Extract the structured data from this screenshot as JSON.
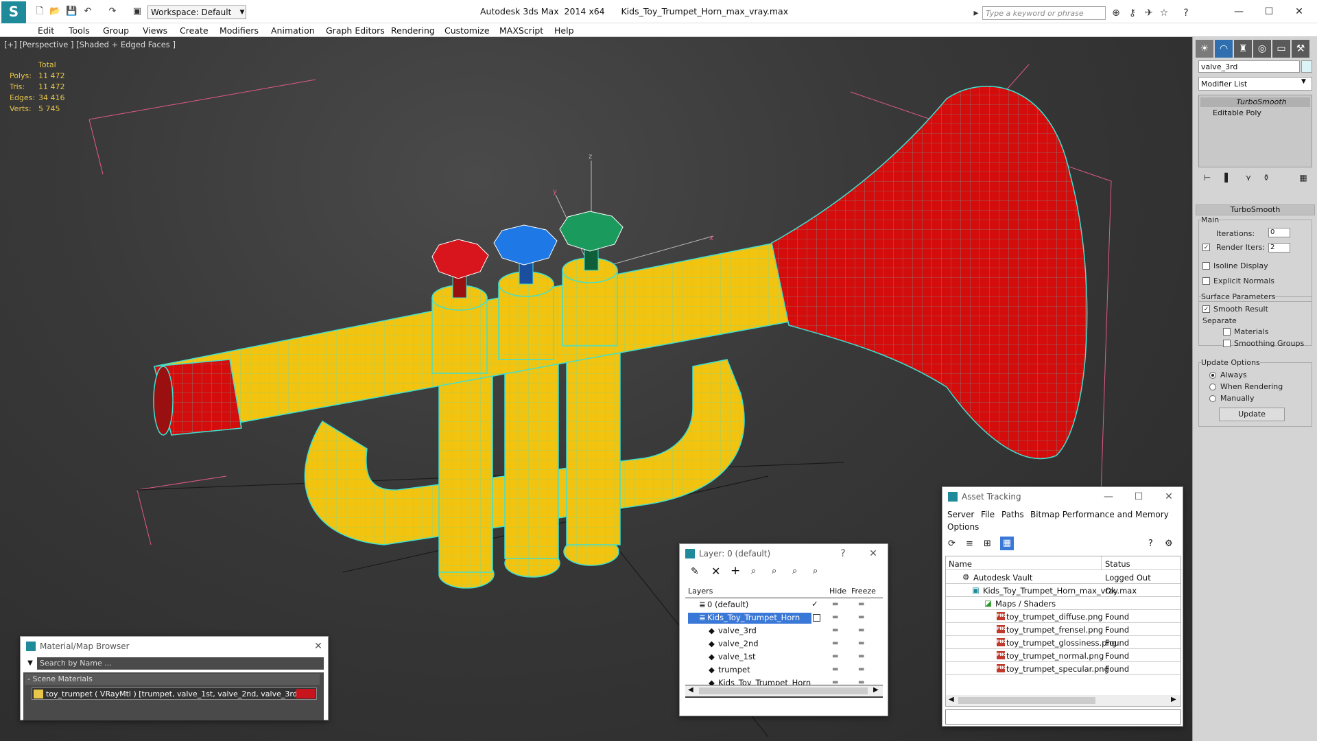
{
  "titlebar": {
    "app_title": "Autodesk 3ds Max  2014 x64      Kids_Toy_Trumpet_Horn_max_vray.max",
    "workspace": "Workspace: Default",
    "search_placeholder": "Type a keyword or phrase"
  },
  "menu": [
    "Edit",
    "Tools",
    "Group",
    "Views",
    "Create",
    "Modifiers",
    "Animation",
    "Graph Editors",
    "Rendering",
    "Customize",
    "MAXScript",
    "Help"
  ],
  "viewport": {
    "label": "[+] [Perspective ] [Shaded + Edged Faces ]",
    "stats_header": "Total",
    "stats": [
      {
        "label": "Polys:",
        "value": "11 472"
      },
      {
        "label": "Tris:",
        "value": "11 472"
      },
      {
        "label": "Edges:",
        "value": "34 416"
      },
      {
        "label": "Verts:",
        "value": "5 745"
      }
    ],
    "axis_z": "z",
    "axis_y": "y",
    "axis_x": "x"
  },
  "command_panel": {
    "object_name": "valve_3rd",
    "modifier_list": "Modifier List",
    "stack": [
      "TurboSmooth",
      "Editable Poly"
    ],
    "rollout_title": "TurboSmooth",
    "main_label": "Main",
    "iterations_label": "Iterations:",
    "iterations_value": "0",
    "render_iters_label": "Render Iters:",
    "render_iters_value": "2",
    "isoline_label": "Isoline Display",
    "explicit_normals_label": "Explicit Normals",
    "surface_params_label": "Surface Parameters",
    "smooth_result_label": "Smooth Result",
    "separate_label": "Separate",
    "materials_label": "Materials",
    "smoothing_groups_label": "Smoothing Groups",
    "update_options_label": "Update Options",
    "always_label": "Always",
    "when_rendering_label": "When Rendering",
    "manually_label": "Manually",
    "update_button": "Update"
  },
  "material_browser": {
    "title": "Material/Map Browser",
    "search_placeholder": "Search by Name ...",
    "section": "- Scene Materials",
    "material": "toy_trumpet  ( VRayMtl )  [trumpet, valve_1st, valve_2nd, valve_3rd]"
  },
  "layer_window": {
    "title": "Layer: 0 (default)",
    "help": "?",
    "col_layers": "Layers",
    "col_hide": "Hide",
    "col_freeze": "Freeze",
    "rows": [
      {
        "name": "0 (default)",
        "indent": 0
      },
      {
        "name": "Kids_Toy_Trumpet_Horn",
        "indent": 0
      },
      {
        "name": "valve_3rd",
        "indent": 1
      },
      {
        "name": "valve_2nd",
        "indent": 1
      },
      {
        "name": "valve_1st",
        "indent": 1
      },
      {
        "name": "trumpet",
        "indent": 1
      },
      {
        "name": "Kids_Toy_Trumpet_Horn",
        "indent": 1
      }
    ]
  },
  "asset_tracking": {
    "title": "Asset Tracking",
    "menu": [
      "Server",
      "File",
      "Paths",
      "Bitmap Performance and Memory",
      "Options"
    ],
    "col_name": "Name",
    "col_status": "Status",
    "rows": [
      {
        "name": "Autodesk Vault",
        "status": "Logged Out",
        "indent": 1
      },
      {
        "name": "Kids_Toy_Trumpet_Horn_max_vray.max",
        "status": "Ok",
        "indent": 2
      },
      {
        "name": "Maps / Shaders",
        "status": "",
        "indent": 3
      },
      {
        "name": "toy_trumpet_diffuse.png",
        "status": "Found",
        "indent": 4
      },
      {
        "name": "toy_trumpet_frensel.png",
        "status": "Found",
        "indent": 4
      },
      {
        "name": "toy_trumpet_glossiness.png",
        "status": "Found",
        "indent": 4
      },
      {
        "name": "toy_trumpet_normal.png",
        "status": "Found",
        "indent": 4
      },
      {
        "name": "toy_trumpet_specular.png",
        "status": "Found",
        "indent": 4
      }
    ]
  },
  "colors": {
    "trumpet_body": "#f2c40f",
    "bell": "#d40c0c",
    "valve_red": "#d8141c",
    "valve_blue": "#1e78e6",
    "valve_green": "#1a9a5c",
    "wire": "#3fe0d0"
  }
}
